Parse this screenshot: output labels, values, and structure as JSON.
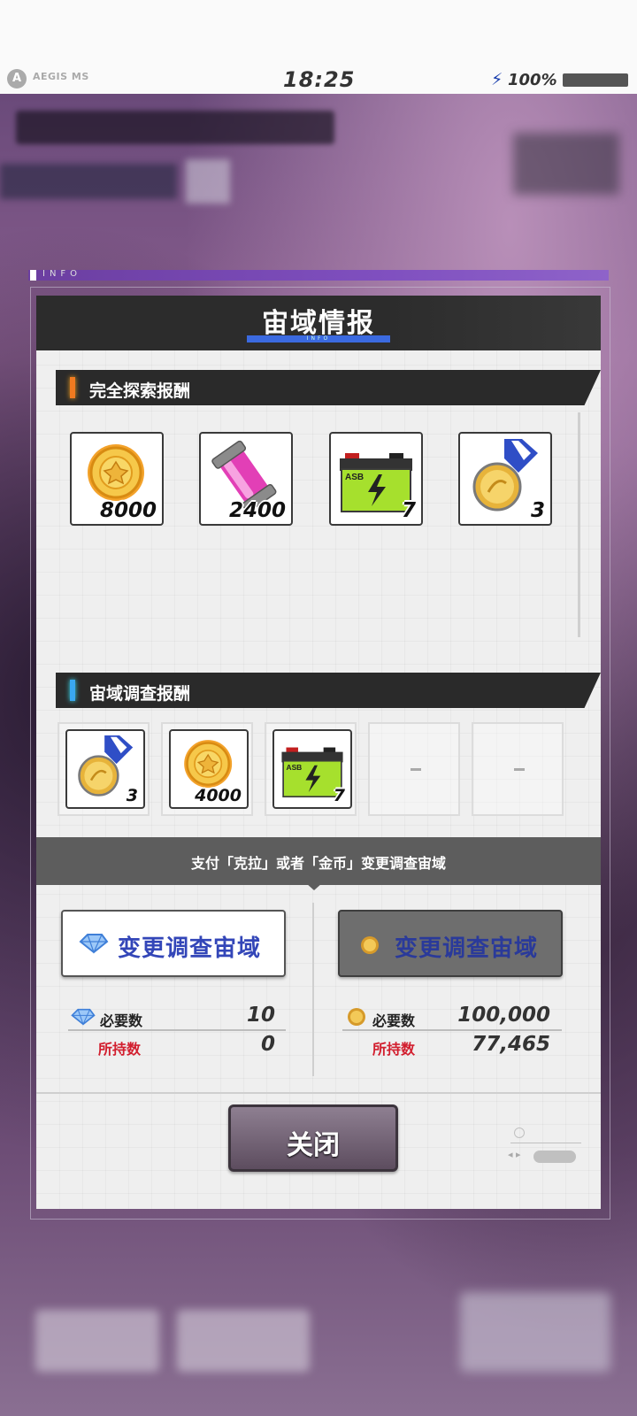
{
  "status_bar": {
    "brand": "AEGIS MS",
    "time": "18:25",
    "battery": "100%"
  },
  "info_tag": "INFO",
  "panel": {
    "title": "宙域情报",
    "title_sub": "INFO"
  },
  "full_reward": {
    "label": "完全探索报酬",
    "items": [
      {
        "name": "coin",
        "qty": "8000"
      },
      {
        "name": "energy-capsule",
        "qty": "2400"
      },
      {
        "name": "battery",
        "qty": "7"
      },
      {
        "name": "medal",
        "qty": "3"
      }
    ]
  },
  "survey_reward": {
    "label": "宙域调查报酬",
    "items": [
      {
        "name": "medal",
        "qty": "3"
      },
      {
        "name": "coin",
        "qty": "4000"
      },
      {
        "name": "battery",
        "qty": "7"
      }
    ]
  },
  "pay_text": "支付「克拉」或者「金币」变更调查宙域",
  "left_option": {
    "button": "变更调查宙域",
    "required_label": "必要数",
    "required_value": "10",
    "owned_label": "所持数",
    "owned_value": "0"
  },
  "right_option": {
    "button": "变更调查宙域",
    "required_label": "必要数",
    "required_value": "100,000",
    "owned_label": "所持数",
    "owned_value": "77,465"
  },
  "close_button": "关闭",
  "colors": {
    "accent_blue": "#3b6ae0",
    "button_text": "#3346b8",
    "owned_red": "#d21e2e",
    "info_purple": "#7f4fbf"
  }
}
